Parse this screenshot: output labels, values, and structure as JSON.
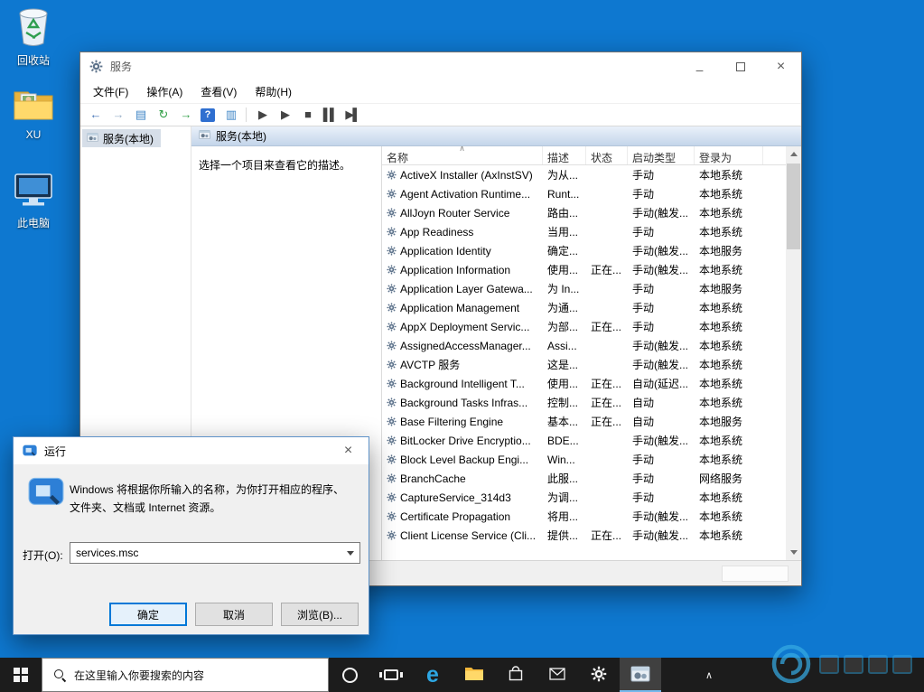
{
  "colors": {
    "desktop": "#0e78d0",
    "accent": "#0078d7",
    "taskbar": "#1c1c1c",
    "taskbar_active_underline": "#76b9ed"
  },
  "glyphs": {
    "minimize": "–",
    "close": "×",
    "sort": "∧",
    "chevron": "∧"
  },
  "desktop": {
    "icons": [
      {
        "label": "回收站"
      },
      {
        "label": "XU"
      },
      {
        "label": "此电脑"
      }
    ]
  },
  "services_window": {
    "title": "服务",
    "menu": [
      "文件(F)",
      "操作(A)",
      "查看(V)",
      "帮助(H)"
    ],
    "tree_item": "服务(本地)",
    "panel_header": "服务(本地)",
    "description_hint": "选择一个项目来查看它的描述。",
    "columns": [
      "名称",
      "描述",
      "状态",
      "启动类型",
      "登录为"
    ],
    "rows": [
      {
        "name": "ActiveX Installer (AxInstSV)",
        "desc": "为从...",
        "status": "",
        "startup": "手动",
        "logon": "本地系统"
      },
      {
        "name": "Agent Activation Runtime...",
        "desc": "Runt...",
        "status": "",
        "startup": "手动",
        "logon": "本地系统"
      },
      {
        "name": "AllJoyn Router Service",
        "desc": "路由...",
        "status": "",
        "startup": "手动(触发...",
        "logon": "本地系统"
      },
      {
        "name": "App Readiness",
        "desc": "当用...",
        "status": "",
        "startup": "手动",
        "logon": "本地系统"
      },
      {
        "name": "Application Identity",
        "desc": "确定...",
        "status": "",
        "startup": "手动(触发...",
        "logon": "本地服务"
      },
      {
        "name": "Application Information",
        "desc": "使用...",
        "status": "正在...",
        "startup": "手动(触发...",
        "logon": "本地系统"
      },
      {
        "name": "Application Layer Gatewa...",
        "desc": "为 In...",
        "status": "",
        "startup": "手动",
        "logon": "本地服务"
      },
      {
        "name": "Application Management",
        "desc": "为通...",
        "status": "",
        "startup": "手动",
        "logon": "本地系统"
      },
      {
        "name": "AppX Deployment Servic...",
        "desc": "为部...",
        "status": "正在...",
        "startup": "手动",
        "logon": "本地系统"
      },
      {
        "name": "AssignedAccessManager...",
        "desc": "Assi...",
        "status": "",
        "startup": "手动(触发...",
        "logon": "本地系统"
      },
      {
        "name": "AVCTP 服务",
        "desc": "这是...",
        "status": "",
        "startup": "手动(触发...",
        "logon": "本地系统"
      },
      {
        "name": "Background Intelligent T...",
        "desc": "使用...",
        "status": "正在...",
        "startup": "自动(延迟...",
        "logon": "本地系统"
      },
      {
        "name": "Background Tasks Infras...",
        "desc": "控制...",
        "status": "正在...",
        "startup": "自动",
        "logon": "本地系统"
      },
      {
        "name": "Base Filtering Engine",
        "desc": "基本...",
        "status": "正在...",
        "startup": "自动",
        "logon": "本地服务"
      },
      {
        "name": "BitLocker Drive Encryptio...",
        "desc": "BDE...",
        "status": "",
        "startup": "手动(触发...",
        "logon": "本地系统"
      },
      {
        "name": "Block Level Backup Engi...",
        "desc": "Win...",
        "status": "",
        "startup": "手动",
        "logon": "本地系统"
      },
      {
        "name": "BranchCache",
        "desc": "此服...",
        "status": "",
        "startup": "手动",
        "logon": "网络服务"
      },
      {
        "name": "CaptureService_314d3",
        "desc": "为调...",
        "status": "",
        "startup": "手动",
        "logon": "本地系统"
      },
      {
        "name": "Certificate Propagation",
        "desc": "将用...",
        "status": "",
        "startup": "手动(触发...",
        "logon": "本地系统"
      },
      {
        "name": "Client License Service (Cli...",
        "desc": "提供...",
        "status": "正在...",
        "startup": "手动(触发...",
        "logon": "本地系统"
      }
    ]
  },
  "toolbar_icons": [
    {
      "name": "back",
      "glyph": "←",
      "color": "#3f6fb5"
    },
    {
      "name": "forward",
      "glyph": "→",
      "color": "#9ab0c9"
    },
    {
      "name": "show-console-tree",
      "glyph": "▤",
      "color": "#3f86c6"
    },
    {
      "name": "refresh",
      "glyph": "↻",
      "color": "#2f9e44"
    },
    {
      "name": "export-list",
      "glyph": "→",
      "color": "#2f9e44"
    },
    {
      "name": "help",
      "glyph": "?",
      "color": "#ffffff",
      "bg": "#2f6fd0",
      "boxed": true
    },
    {
      "name": "extended-view",
      "glyph": "▥",
      "color": "#3f86c6"
    },
    {
      "type": "sep"
    },
    {
      "name": "service-start",
      "glyph": "▶",
      "color": "#444444"
    },
    {
      "name": "service-resume",
      "glyph": "▶",
      "color": "#444444"
    },
    {
      "name": "service-stop",
      "glyph": "■",
      "color": "#444444"
    },
    {
      "name": "service-pause",
      "glyph": "▌▌",
      "color": "#444444"
    },
    {
      "name": "service-restart",
      "glyph": "▶▌",
      "color": "#444444"
    }
  ],
  "run_dialog": {
    "title": "运行",
    "description_line1": "Windows 将根据你所输入的名称，为你打开相应的程序、",
    "description_line2": "文件夹、文档或 Internet 资源。",
    "open_label": "打开(O):",
    "open_value": "services.msc",
    "buttons": [
      "确定",
      "取消",
      "浏览(B)..."
    ]
  },
  "taskbar": {
    "search_placeholder": "在这里输入你要搜索的内容"
  }
}
